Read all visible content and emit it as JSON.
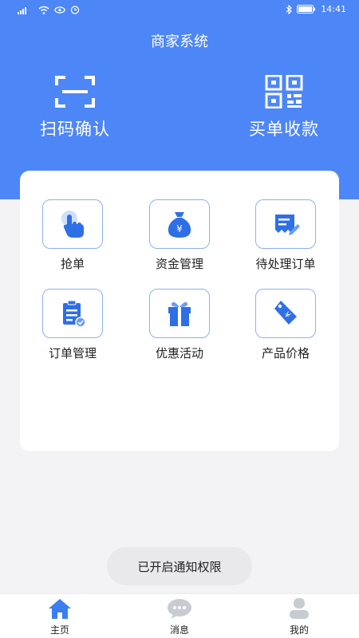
{
  "status_bar": {
    "time": "14:41"
  },
  "header": {
    "title": "商家系统"
  },
  "quick_actions": [
    {
      "label": "扫码确认",
      "icon": "scan-icon"
    },
    {
      "label": "买单收款",
      "icon": "qr-code-icon"
    }
  ],
  "grid": [
    {
      "label": "抢单",
      "icon": "tap-hand-icon"
    },
    {
      "label": "资金管理",
      "icon": "money-bag-icon"
    },
    {
      "label": "待处理订单",
      "icon": "edit-document-icon"
    },
    {
      "label": "订单管理",
      "icon": "clipboard-check-icon"
    },
    {
      "label": "优惠活动",
      "icon": "gift-icon"
    },
    {
      "label": "产品价格",
      "icon": "price-tag-icon"
    }
  ],
  "toast": {
    "text": "已开启通知权限"
  },
  "tabbar": [
    {
      "label": "主页",
      "icon": "home-icon",
      "active": true
    },
    {
      "label": "消息",
      "icon": "chat-bubble-icon",
      "active": false
    },
    {
      "label": "我的",
      "icon": "user-icon",
      "active": false
    }
  ],
  "colors": {
    "primary": "#4d86f7",
    "background": "#f3f3f5",
    "inactive_icon": "#c8cbd2"
  }
}
